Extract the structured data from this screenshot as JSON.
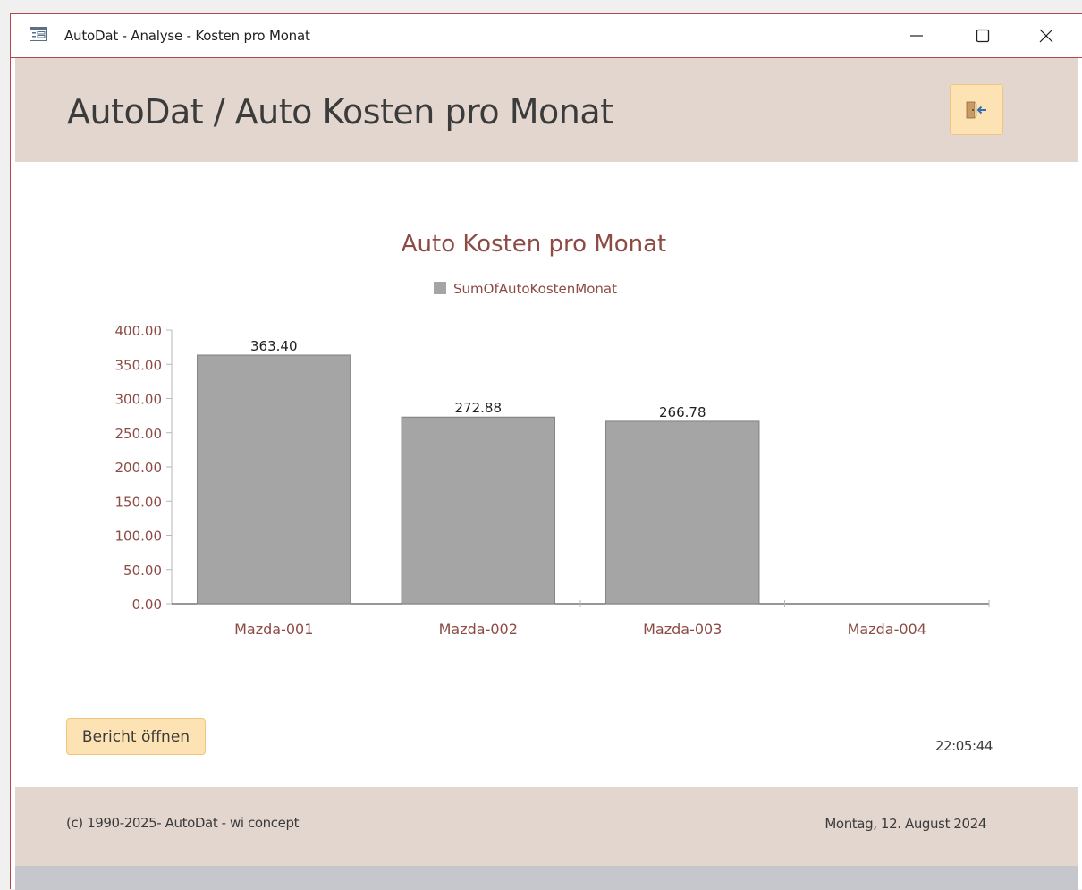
{
  "window": {
    "title": "AutoDat - Analyse - Kosten pro Monat",
    "accent_color": "#b7474f",
    "icons": [
      "form-icon",
      "minimize-icon",
      "maximize-icon",
      "close-icon"
    ]
  },
  "header": {
    "title": "AutoDat / Auto Kosten pro Monat",
    "background": "#e3d6cf",
    "exit_icon": "exit-door-icon"
  },
  "chart_data": {
    "type": "bar",
    "title": "Auto Kosten pro Monat",
    "legend": [
      "SumOfAutoKostenMonat"
    ],
    "legend_position": "top",
    "categories": [
      "Mazda-001",
      "Mazda-002",
      "Mazda-003",
      "Mazda-004"
    ],
    "series": [
      {
        "name": "SumOfAutoKostenMonat",
        "values": [
          363.4,
          272.88,
          266.78,
          null
        ],
        "color": "#a5a5a5"
      }
    ],
    "data_labels": [
      "363.40",
      "272.88",
      "266.78",
      ""
    ],
    "y_ticks": [
      "0.00",
      "50.00",
      "100.00",
      "150.00",
      "200.00",
      "250.00",
      "300.00",
      "350.00",
      "400.00"
    ],
    "ylim": [
      0,
      400
    ],
    "grid": false,
    "axis_text_color": "#8c4b45"
  },
  "actions": {
    "report_button": "Bericht öffnen",
    "button_color": "#fde3b3"
  },
  "status": {
    "time": "22:05:44"
  },
  "footer": {
    "copyright": "(c) 1990-2025- AutoDat - wi concept",
    "date": "Montag, 12. August 2024"
  }
}
